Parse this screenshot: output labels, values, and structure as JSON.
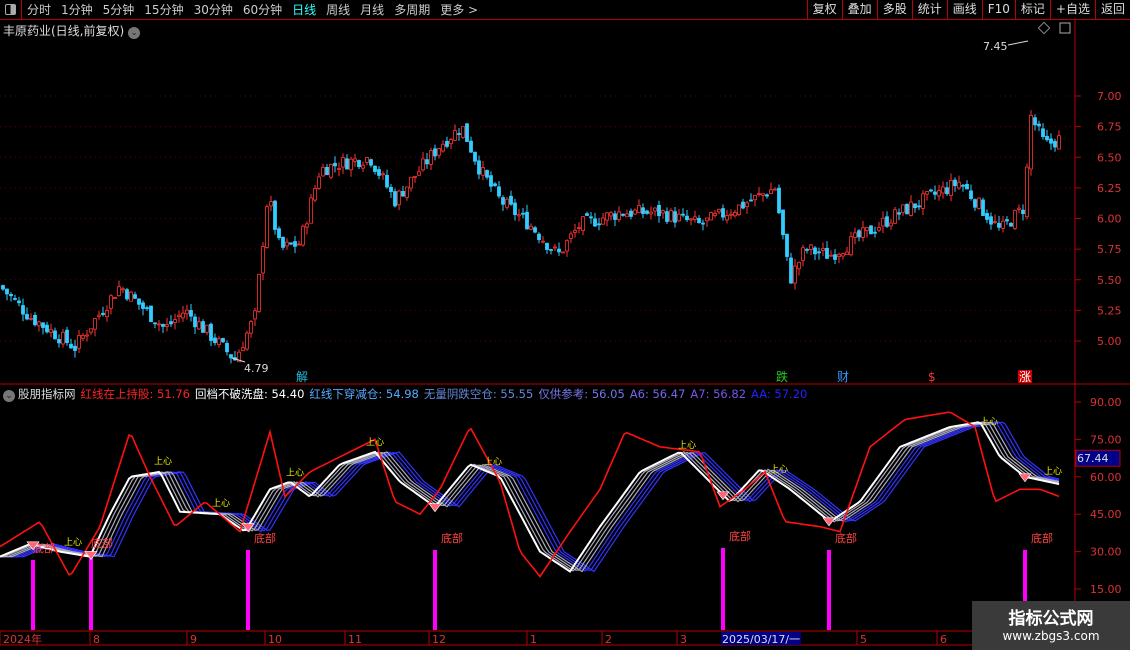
{
  "toolbar": {
    "periods": [
      "分时",
      "1分钟",
      "5分钟",
      "15分钟",
      "30分钟",
      "60分钟",
      "日线",
      "周线",
      "月线",
      "多周期",
      "更多 >"
    ],
    "active": "日线",
    "buttons": [
      "复权",
      "叠加",
      "多股",
      "统计",
      "画线",
      "F10",
      "标记",
      "+自选",
      "返回"
    ]
  },
  "stock_title": "丰原药业(日线,前复权)",
  "price_axis": [
    "7.00",
    "6.75",
    "6.50",
    "6.25",
    "6.00",
    "5.75",
    "5.50",
    "5.25",
    "5.00"
  ],
  "annotations": {
    "high": "7.45",
    "low": "4.79"
  },
  "event_markers": [
    {
      "text": "解",
      "color": "#2bd"
    },
    {
      "text": "跌",
      "color": "#2c2"
    },
    {
      "text": "财",
      "color": "#39f"
    },
    {
      "text": "$",
      "color": "#f33"
    },
    {
      "text": "涨",
      "color": "#fff"
    }
  ],
  "indicator": {
    "name": "股朋指标网",
    "items": [
      {
        "label": "红线在上持股: 51.76",
        "color": "#f22"
      },
      {
        "label": "回档不破洗盘: 54.40",
        "color": "#fff"
      },
      {
        "label": "红线下穿减仓: 54.98",
        "color": "#5af"
      },
      {
        "label": "无量阴跌空仓: 55.55",
        "color": "#68d"
      },
      {
        "label": "仅供参考: 56.05",
        "color": "#77e"
      },
      {
        "label": "A6: 56.47",
        "color": "#76e"
      },
      {
        "label": "A7: 56.82",
        "color": "#75e"
      },
      {
        "label": "AA: 57.20",
        "color": "#22f"
      }
    ],
    "axis": [
      "90.00",
      "75.00",
      "60.00",
      "45.00",
      "30.00",
      "15.00"
    ],
    "current": "67.44",
    "bottom_label": "底部",
    "signal_label": "上心"
  },
  "time_axis": [
    "2024年",
    "8",
    "9",
    "10",
    "11",
    "12",
    "1",
    "2",
    "3",
    "2025/03/17/一",
    "5",
    "6"
  ],
  "watermark": {
    "name": "指标公式网",
    "url": "www.zbgs3.com"
  },
  "chart_data": {
    "type": "candlestick",
    "price_range": [
      4.7,
      7.5
    ],
    "close_keypoints": [
      [
        0,
        5.45
      ],
      [
        30,
        5.2
      ],
      [
        75,
        4.95
      ],
      [
        120,
        5.45
      ],
      [
        165,
        5.1
      ],
      [
        185,
        5.25
      ],
      [
        235,
        4.85
      ],
      [
        255,
        5.2
      ],
      [
        268,
        6.2
      ],
      [
        280,
        5.75
      ],
      [
        300,
        5.8
      ],
      [
        320,
        6.4
      ],
      [
        340,
        6.45
      ],
      [
        370,
        6.5
      ],
      [
        395,
        6.15
      ],
      [
        440,
        6.6
      ],
      [
        462,
        6.75
      ],
      [
        480,
        6.4
      ],
      [
        500,
        6.15
      ],
      [
        530,
        5.95
      ],
      [
        558,
        5.7
      ],
      [
        580,
        5.95
      ],
      [
        620,
        6.05
      ],
      [
        660,
        6.05
      ],
      [
        700,
        5.95
      ],
      [
        740,
        6.1
      ],
      [
        775,
        6.25
      ],
      [
        790,
        5.5
      ],
      [
        805,
        5.75
      ],
      [
        830,
        5.7
      ],
      [
        860,
        5.85
      ],
      [
        900,
        6.05
      ],
      [
        960,
        6.3
      ],
      [
        1000,
        5.9
      ],
      [
        1025,
        6.1
      ],
      [
        1030,
        6.85
      ],
      [
        1045,
        6.6
      ],
      [
        1060,
        6.65
      ]
    ],
    "indicator_red": [
      [
        0,
        32
      ],
      [
        40,
        42
      ],
      [
        70,
        20
      ],
      [
        100,
        40
      ],
      [
        130,
        78
      ],
      [
        150,
        60
      ],
      [
        175,
        40
      ],
      [
        205,
        50
      ],
      [
        240,
        38
      ],
      [
        270,
        78
      ],
      [
        285,
        52
      ],
      [
        310,
        62
      ],
      [
        340,
        68
      ],
      [
        375,
        75
      ],
      [
        395,
        50
      ],
      [
        420,
        45
      ],
      [
        440,
        55
      ],
      [
        470,
        80
      ],
      [
        500,
        58
      ],
      [
        520,
        30
      ],
      [
        540,
        20
      ],
      [
        570,
        38
      ],
      [
        600,
        55
      ],
      [
        625,
        78
      ],
      [
        660,
        72
      ],
      [
        700,
        70
      ],
      [
        720,
        48
      ],
      [
        745,
        55
      ],
      [
        765,
        62
      ],
      [
        785,
        42
      ],
      [
        820,
        40
      ],
      [
        840,
        38
      ],
      [
        870,
        72
      ],
      [
        905,
        83
      ],
      [
        950,
        86
      ],
      [
        975,
        80
      ],
      [
        995,
        50
      ],
      [
        1020,
        55
      ],
      [
        1040,
        55
      ],
      [
        1060,
        52
      ]
    ],
    "indicator_white": [
      [
        0,
        28
      ],
      [
        30,
        33
      ],
      [
        60,
        30
      ],
      [
        90,
        28
      ],
      [
        110,
        45
      ],
      [
        130,
        60
      ],
      [
        160,
        62
      ],
      [
        180,
        46
      ],
      [
        220,
        45
      ],
      [
        245,
        38
      ],
      [
        270,
        55
      ],
      [
        290,
        58
      ],
      [
        310,
        52
      ],
      [
        340,
        65
      ],
      [
        375,
        70
      ],
      [
        400,
        58
      ],
      [
        435,
        48
      ],
      [
        470,
        65
      ],
      [
        500,
        60
      ],
      [
        540,
        30
      ],
      [
        570,
        22
      ],
      [
        600,
        40
      ],
      [
        640,
        62
      ],
      [
        680,
        70
      ],
      [
        710,
        58
      ],
      [
        730,
        50
      ],
      [
        760,
        63
      ],
      [
        790,
        55
      ],
      [
        830,
        42
      ],
      [
        860,
        50
      ],
      [
        900,
        72
      ],
      [
        950,
        80
      ],
      [
        980,
        82
      ],
      [
        1000,
        68
      ],
      [
        1025,
        60
      ],
      [
        1060,
        57
      ]
    ],
    "indicator_range": [
      5,
      98
    ]
  }
}
